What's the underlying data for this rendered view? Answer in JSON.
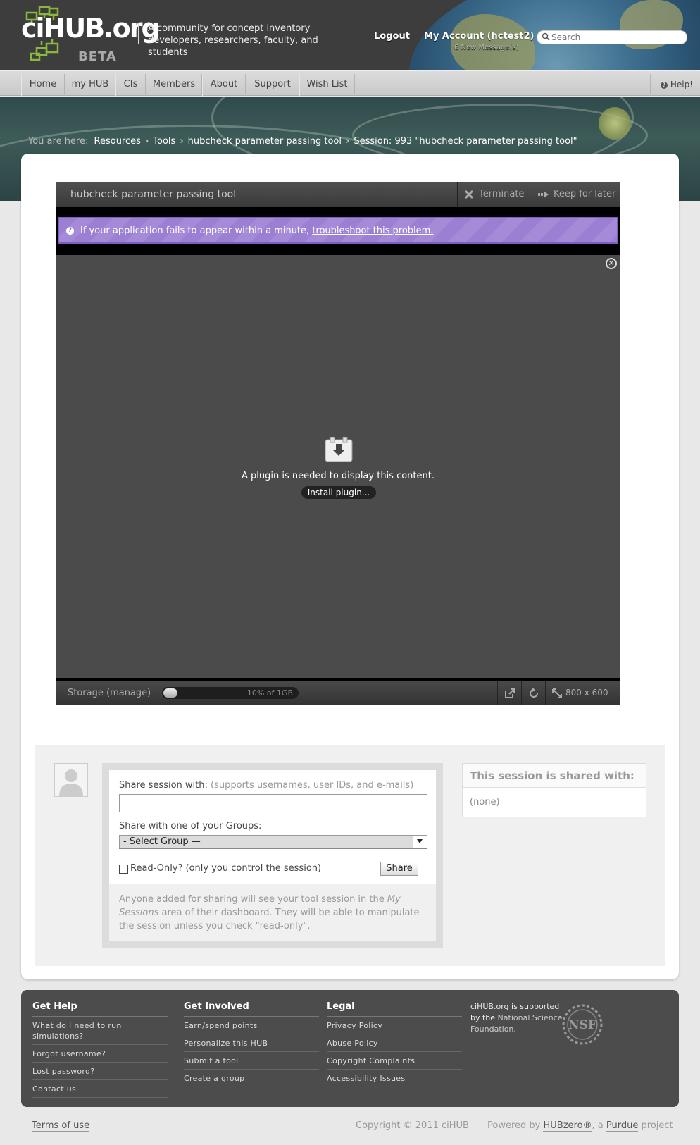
{
  "header": {
    "logo_text": "ciHUB.org",
    "logo_badge": "BETA",
    "tagline": "A community for concept inventory developers, researchers, faculty, and students",
    "logout_label": "Logout",
    "account_label": "My Account (hctest2)",
    "messages_label": "6 New Message(s)",
    "search_placeholder": "Search"
  },
  "nav": {
    "items": [
      {
        "label": "Home"
      },
      {
        "label": "my HUB"
      },
      {
        "label": "CIs"
      },
      {
        "label": "Members"
      },
      {
        "label": "About"
      },
      {
        "label": "Support"
      },
      {
        "label": "Wish List"
      }
    ],
    "help_label": "Help!"
  },
  "breadcrumb": {
    "prefix": "You are here:",
    "items": [
      "Resources",
      "Tools",
      "hubcheck parameter passing tool",
      "Session: 993 \"hubcheck parameter passing tool\""
    ]
  },
  "tool": {
    "title": "hubcheck parameter passing tool",
    "terminate_label": "Terminate",
    "keep_label": "Keep for later",
    "notice_text": "If your application fails to appear within a minute,",
    "notice_link": "troubleshoot this problem.",
    "plugin_message": "A plugin is needed to display this content.",
    "plugin_button": "Install plugin...",
    "storage_label": "Storage (manage)",
    "storage_text": "10% of 1GB",
    "storage_fraction": 0.1,
    "size_label": "800 x 600"
  },
  "share": {
    "label": "Share session with:",
    "label_hint": "(supports usernames, user IDs, and e-mails)",
    "input_value": "",
    "group_label": "Share with one of your Groups:",
    "group_selected": "- Select Group —",
    "readonly_label": "Read-Only? (only you control the session)",
    "share_button": "Share",
    "help_text_1": "Anyone added for sharing will see your tool session in the ",
    "help_text_em": "My Sessions",
    "help_text_2": " area of their dashboard. They will be able to manipulate the session unless you check \"read-only\".",
    "shared_title": "This session is shared with:",
    "shared_none": "(none)"
  },
  "footer": {
    "columns": [
      {
        "title": "Get Help",
        "links": [
          "What do I need to run simulations?",
          "Forgot username?",
          "Lost password?",
          "Contact us"
        ]
      },
      {
        "title": "Get Involved",
        "links": [
          "Earn/spend points",
          "Personalize this HUB",
          "Submit a tool",
          "Create a group"
        ]
      },
      {
        "title": "Legal",
        "links": [
          "Privacy Policy",
          "Abuse Policy",
          "Copyright Complaints",
          "Accessibility Issues"
        ]
      }
    ],
    "support_text_1": "ciHUB.org is supported by the ",
    "support_text_link": "National Science Foundation",
    "support_text_2": ".",
    "nsf_logo_text": "NSF"
  },
  "bottom": {
    "terms_label": "Terms of use",
    "copyright": "Copyright © 2011 ciHUB",
    "powered_1": "Powered by ",
    "powered_hubzero": "HUBzero®",
    "powered_2": ", a ",
    "powered_purdue": "Purdue",
    "powered_3": " project"
  },
  "colors": {
    "header_bg": "#3d3d3d",
    "notice_purple": "#9b7fd2",
    "logo_green": "#8bb83a",
    "footer_bg": "#4c4c4c"
  }
}
